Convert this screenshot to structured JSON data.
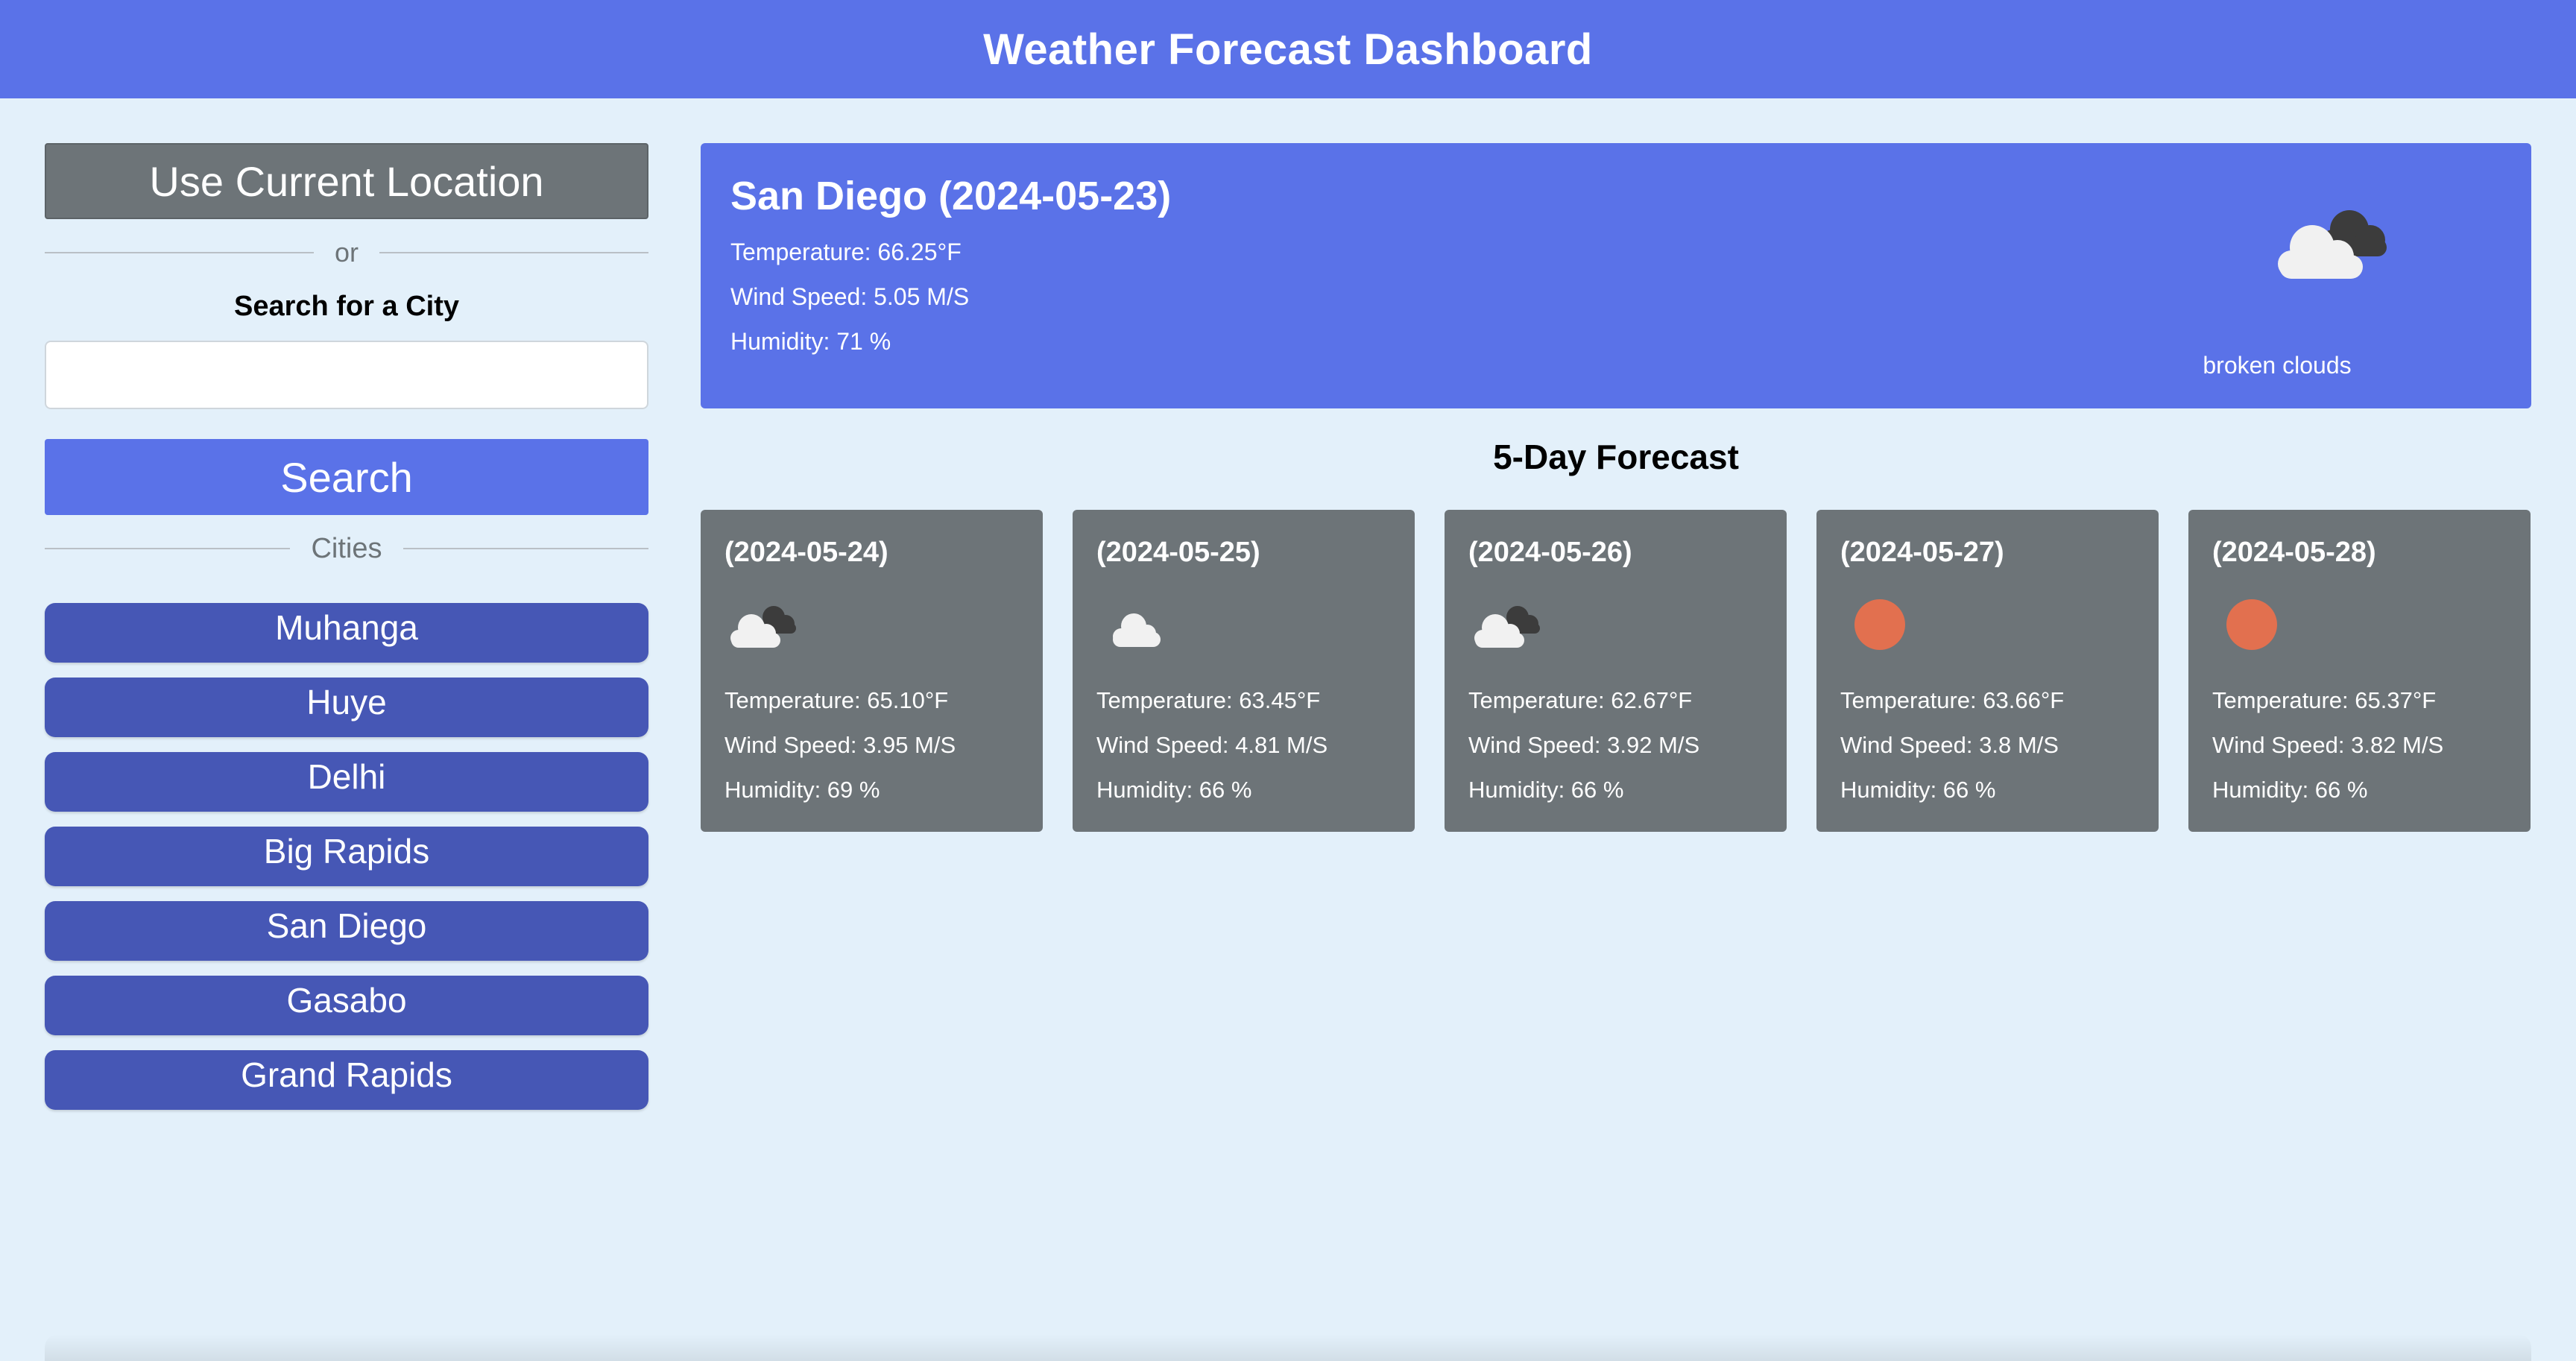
{
  "header": {
    "title": "Weather Forecast Dashboard"
  },
  "sidebar": {
    "use_location_label": "Use Current Location",
    "or_label": "or",
    "search_label": "Search for a City",
    "search_input": {
      "value": "",
      "placeholder": ""
    },
    "search_button_label": "Search",
    "cities_label": "Cities",
    "cities": [
      "Muhanga",
      "Huye",
      "Delhi",
      "Big Rapids",
      "San Diego",
      "Gasabo",
      "Grand Rapids"
    ]
  },
  "current": {
    "title": "San Diego (2024-05-23)",
    "temperature": "Temperature: 66.25°F",
    "wind": "Wind Speed: 5.05 M/S",
    "humidity": "Humidity: 71 %",
    "icon": "broken-clouds-icon",
    "description": "broken clouds"
  },
  "forecast": {
    "heading": "5-Day Forecast",
    "days": [
      {
        "date": "(2024-05-24)",
        "icon": "broken-clouds-icon",
        "temperature": "Temperature: 65.10°F",
        "wind": "Wind Speed: 3.95 M/S",
        "humidity": "Humidity: 69 %"
      },
      {
        "date": "(2024-05-25)",
        "icon": "few-clouds-icon",
        "temperature": "Temperature: 63.45°F",
        "wind": "Wind Speed: 4.81 M/S",
        "humidity": "Humidity: 66 %"
      },
      {
        "date": "(2024-05-26)",
        "icon": "broken-clouds-icon",
        "temperature": "Temperature: 62.67°F",
        "wind": "Wind Speed: 3.92 M/S",
        "humidity": "Humidity: 66 %"
      },
      {
        "date": "(2024-05-27)",
        "icon": "clear-sky-sun-icon",
        "temperature": "Temperature: 63.66°F",
        "wind": "Wind Speed: 3.8 M/S",
        "humidity": "Humidity: 66 %"
      },
      {
        "date": "(2024-05-28)",
        "icon": "clear-sky-sun-icon",
        "temperature": "Temperature: 65.37°F",
        "wind": "Wind Speed: 3.82 M/S",
        "humidity": "Humidity: 66 %"
      }
    ]
  },
  "colors": {
    "accent": "#5a72e8",
    "city_button": "#4657b5",
    "card_gray": "#6d7478",
    "background": "#e3f0fa",
    "sun": "#e2704f"
  }
}
